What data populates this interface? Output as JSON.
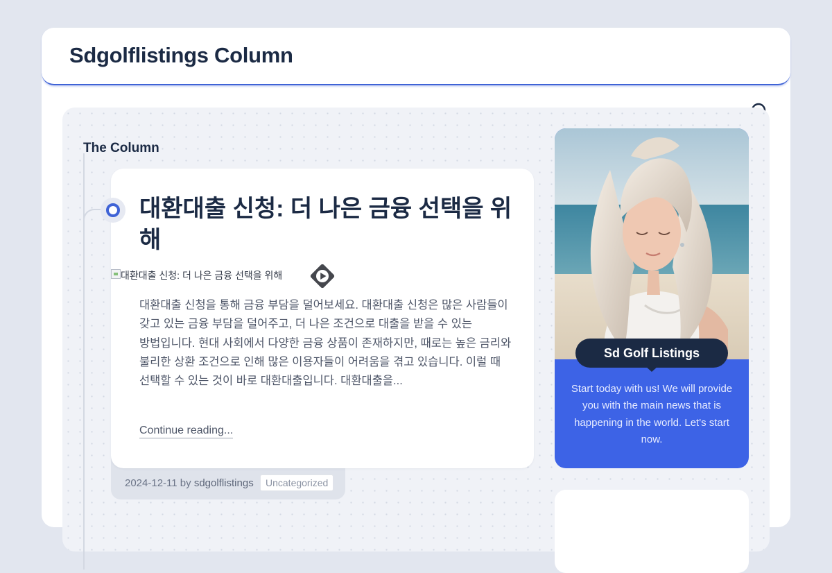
{
  "site": {
    "title": "Sdgolflistings Column"
  },
  "section": {
    "title": "The Column"
  },
  "post": {
    "title": "대환대출 신청: 더 나은 금융 선택을 위해",
    "image_alt": "대환대출 신청: 더 나은 금융 선택을 위해",
    "excerpt": "대환대출 신청을 통해 금융 부담을 덜어보세요. 대환대출 신청은 많은 사람들이 갖고 있는 금융 부담을 덜어주고, 더 나은 조건으로 대출을 받을 수 있는 방법입니다. 현대 사회에서 다양한 금융 상품이 존재하지만, 때로는 높은 금리와 불리한 상환 조건으로 인해 많은 이용자들이 어려움을 겪고 있습니다. 이럴 때 선택할 수 있는 것이 바로 대환대출입니다. 대환대출을...",
    "continue_label": "Continue reading...",
    "date": "2024-12-11",
    "by_label": "by",
    "author": "sdgolflistings",
    "category": "Uncategorized"
  },
  "promo": {
    "badge": "Sd Golf Listings",
    "text": "Start today with us! We will provide you with the main news that is happening in the world. Let's start now."
  },
  "icons": {
    "search": "search-icon",
    "play": "play-icon",
    "broken_image": "broken-image-icon"
  },
  "colors": {
    "page_background": "#e2e6ef",
    "accent": "#3f63d6",
    "promo_background": "#3d63e6",
    "heading": "#1b2a44",
    "content_background": "#f0f2f7"
  }
}
